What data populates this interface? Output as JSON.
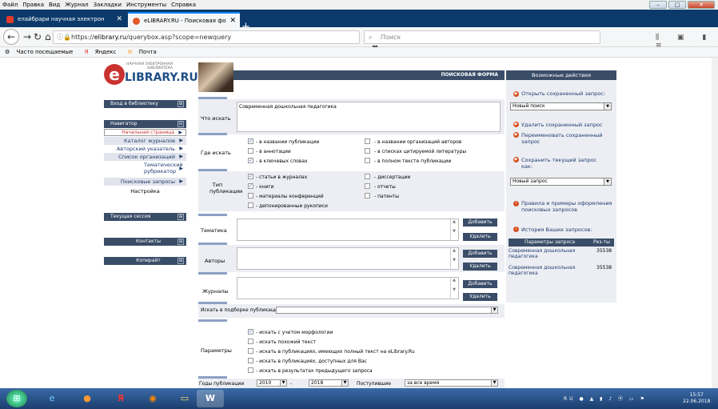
{
  "menu": [
    "Файл",
    "Правка",
    "Вид",
    "Журнал",
    "Закладки",
    "Инструменты",
    "Справка"
  ],
  "tabs": [
    {
      "label": "елайбрари научная электрон"
    },
    {
      "label": "eLIBRARY.RU - Поисковая фо"
    }
  ],
  "url": {
    "prefix": "https://",
    "host": "elibrary.ru",
    "path": "/querybox.asp?scope=newquery"
  },
  "search_placeholder": "Поиск",
  "bookmarks": [
    "Часто посещаемые",
    "Яндекс",
    "Почта"
  ],
  "logo": {
    "small": "НАУЧНАЯ ЭЛЕКТРОННАЯ БИБЛИОТЕКА",
    "big": "LIBRARY.RU",
    "letter": "e"
  },
  "left": {
    "login": "Вход в библиотеку",
    "navigator": "Навигатор",
    "nav_items": [
      "Начальная страница",
      "Каталог журналов",
      "Авторский указатель",
      "Список организаций",
      "Тематический рубрикатор",
      "Поисковые запросы",
      "Настройка"
    ],
    "session": "Текущая сессия",
    "contacts": "Контакты",
    "copyright": "Копирайт"
  },
  "form": {
    "title": "ПОИСКОВАЯ ФОРМА",
    "what_label": "Что искать",
    "what_value": "Современная дошкольная педагогика",
    "where_label": "Где искать",
    "where": [
      {
        "t": "- в названии публикации",
        "c": true
      },
      {
        "t": "- в аннотации",
        "c": false
      },
      {
        "t": "- в ключевых словах",
        "c": true
      },
      {
        "t": "- в названии организаций авторов",
        "c": false
      },
      {
        "t": "- в списках цитируемой литературы",
        "c": false
      },
      {
        "t": "- в полном тексте публикации",
        "c": false
      }
    ],
    "type_label": "Тип публикации",
    "types": [
      {
        "t": "- статьи в журналах",
        "c": true
      },
      {
        "t": "- книги",
        "c": true
      },
      {
        "t": "- материалы конференций",
        "c": false
      },
      {
        "t": "- депонированные рукописи",
        "c": false
      },
      {
        "t": "- диссертации",
        "c": false
      },
      {
        "t": "- отчеты",
        "c": false
      },
      {
        "t": "- патенты",
        "c": false
      }
    ],
    "theme_label": "Тематика",
    "authors_label": "Авторы",
    "journals_label": "Журналы",
    "add": "Добавить",
    "remove": "Удалить",
    "collection_label": "Искать в подборке публикаций",
    "params_label": "Параметры",
    "params": [
      {
        "t": "- искать с учетом морфологии",
        "c": true
      },
      {
        "t": "- искать похожий текст",
        "c": false
      },
      {
        "t": "- искать в публикациях, имеющих полный текст на eLibrary.Ru",
        "c": false
      },
      {
        "t": "- искать в публикациях, доступных для Вас",
        "c": false
      },
      {
        "t": "- искать в результатах предыдущего запроса",
        "c": false
      }
    ],
    "years_label": "Годы публикации",
    "year_from": "2010",
    "year_to": "2018",
    "incoming_label": "Поступившие",
    "incoming_value": "за все время"
  },
  "right": {
    "title": "Возможные действия",
    "open_saved": "Открыть сохраненный запрос:",
    "select1": "Новый поиск",
    "delete_saved": "Удалить сохраненный запрос",
    "rename_saved": "Переименовать сохраненный запрос",
    "save_as": "Сохранить текущий запрос как:",
    "select2": "Новый запрос",
    "rules": "Правила и примеры оформления поисковых запросов",
    "history": "История Ваших запросов:",
    "hist_col1": "Параметры запроса",
    "hist_col2": "Рез-ты",
    "hist": [
      {
        "q": "Современная дошкольная педагогика",
        "n": "35538"
      },
      {
        "q": "Современная дошкольная педагогика",
        "n": "35538"
      }
    ]
  },
  "taskbar": {
    "lang": "RU",
    "time": "15:57",
    "date": "22.06.2018"
  }
}
